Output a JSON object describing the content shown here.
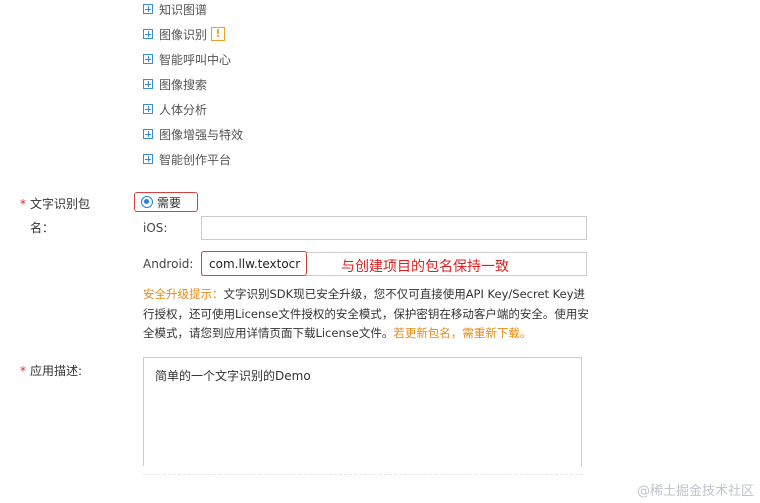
{
  "tree": {
    "items": [
      {
        "label": "知识图谱"
      },
      {
        "label": "图像识别"
      },
      {
        "label": "智能呼叫中心"
      },
      {
        "label": "图像搜索"
      },
      {
        "label": "人体分析"
      },
      {
        "label": "图像增强与特效"
      },
      {
        "label": "智能创作平台"
      }
    ],
    "warning_glyph": "!"
  },
  "package_field": {
    "required_mark": "*",
    "label_line1": "文字识别包",
    "label_line2": "名：",
    "radio_label": "需要",
    "ios_label": "iOS:",
    "ios_value": "",
    "android_label": "Android:",
    "android_value": "com.llw.textocr",
    "annotation": "与创建项目的包名保持一致"
  },
  "notice": {
    "prefix": "安全升级提示：",
    "body": "文字识别SDK现已安全升级，您不仅可直接使用API Key/Secret Key进行授权，还可使用License文件授权的安全模式，保护密钥在移动客户端的安全。使用安全模式，请您到应用详情页面下载License文件。",
    "suffix": "若更新包名，需重新下载。"
  },
  "description_field": {
    "required_mark": "*",
    "label": "应用描述:",
    "value": "简单的一个文字识别的Demo"
  },
  "watermark": "@稀土掘金技术社区",
  "colors": {
    "accent_blue": "#2a7fd4",
    "highlight_red": "#d94040",
    "notice_orange": "#e88a12",
    "warning_orange": "#f0a020"
  }
}
